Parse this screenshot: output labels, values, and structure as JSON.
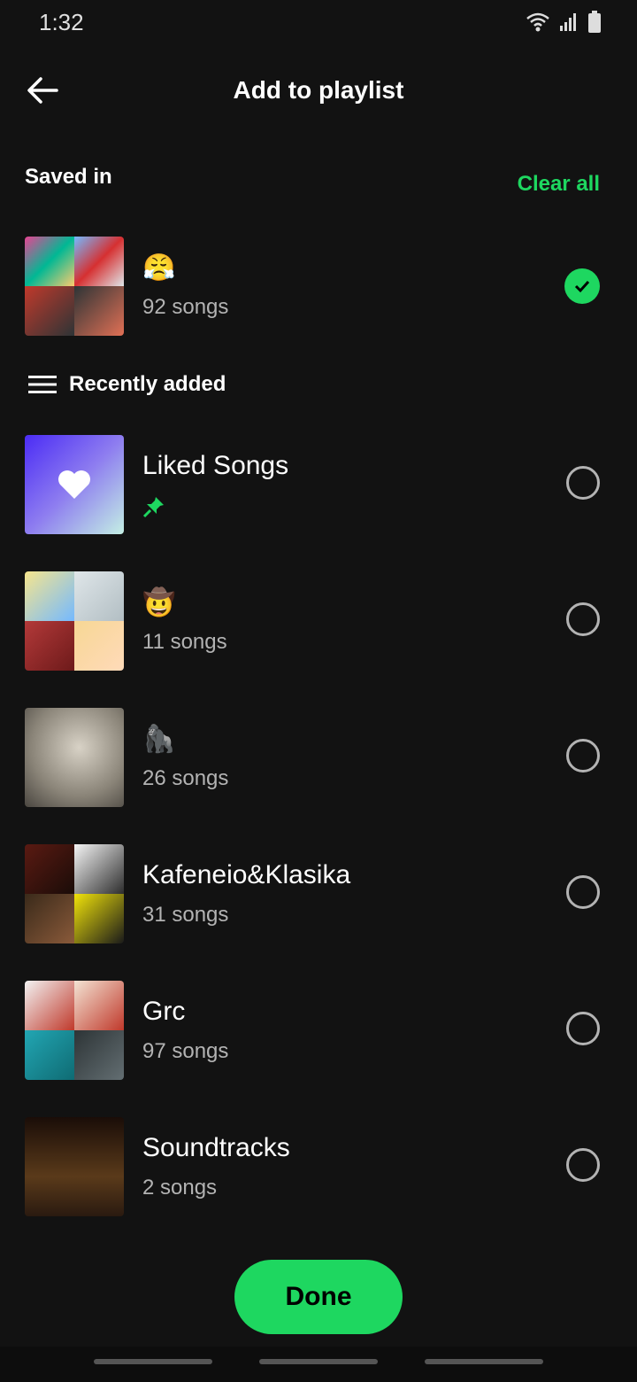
{
  "status": {
    "time": "1:32"
  },
  "header": {
    "title": "Add to playlist"
  },
  "saved_section": {
    "label": "Saved in",
    "clear_all": "Clear all"
  },
  "saved_playlist": {
    "name": "😤",
    "meta": "92 songs",
    "selected": true
  },
  "sort": {
    "label": "Recently added"
  },
  "playlists": [
    {
      "name": "Liked Songs",
      "meta": "",
      "pinned": true
    },
    {
      "name": "🤠",
      "meta": "11 songs"
    },
    {
      "name": "🦍",
      "meta": "26 songs"
    },
    {
      "name": "Kafeneio&Klasika",
      "meta": "31 songs"
    },
    {
      "name": "Grc",
      "meta": "97 songs"
    },
    {
      "name": "Soundtracks",
      "meta": "2 songs"
    }
  ],
  "done_label": "Done",
  "colors": {
    "accent": "#1ed760",
    "background": "#121212",
    "secondary_text": "#b3b3b3"
  }
}
